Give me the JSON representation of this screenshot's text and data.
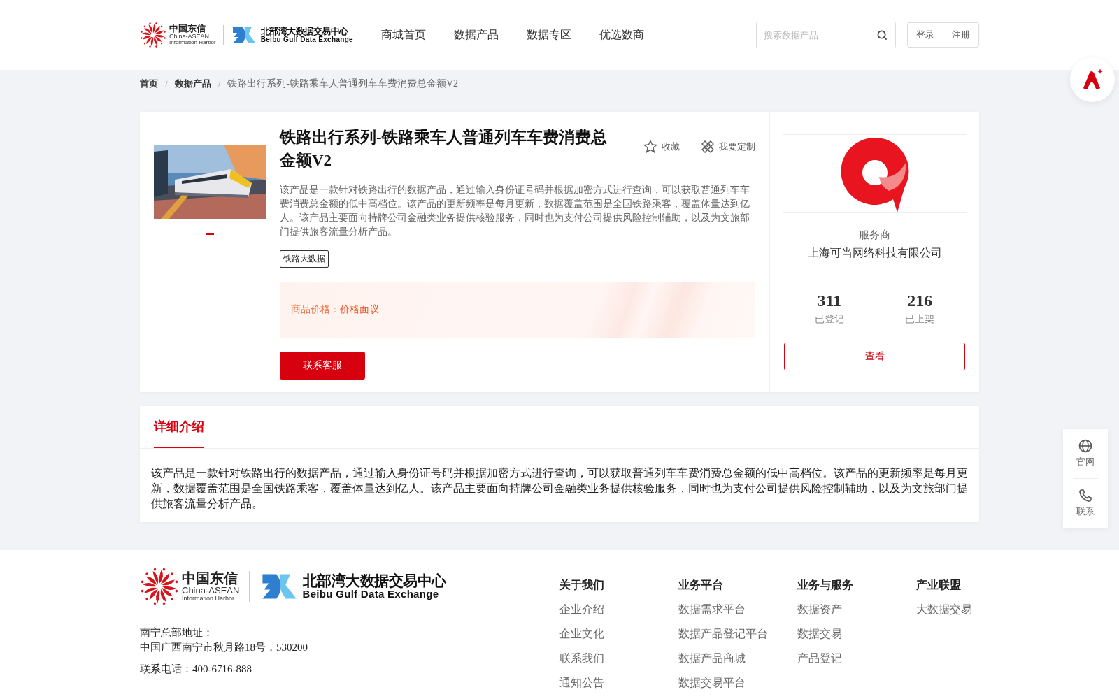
{
  "header": {
    "logo1": {
      "cn": "中国东信",
      "en": "China-ASEAN",
      "sub": "Information Harbor"
    },
    "logo2": {
      "cn": "北部湾大数据交易中心",
      "en": "Beibu Gulf Data Exchange"
    },
    "nav": [
      {
        "label": "商城首页",
        "selected": false
      },
      {
        "label": "数据产品",
        "selected": false
      },
      {
        "label": "数据专区",
        "selected": false
      },
      {
        "label": "优选数商",
        "selected": false
      }
    ],
    "search": {
      "placeholder": "搜索数据产品"
    },
    "auth": [
      "登录",
      "注册"
    ]
  },
  "breadcrumb_separator": "/",
  "breadcrumb": [
    "首页",
    "数据产品",
    "铁路出行系列-铁路乘车人普通列车车费消费总金额V2"
  ],
  "product": {
    "title": "铁路出行系列-铁路乘车人普通列车车费消费总金额V2",
    "actions": [
      {
        "kind": "star",
        "label": "收藏"
      },
      {
        "kind": "tool",
        "label": "我要定制"
      }
    ],
    "description": "该产品是一款针对铁路出行的数据产品，通过输入身份证号码并根据加密方式进行查询，可以获取普通列车车费消费总金额的低中高档位。该产品的更新频率是每月更新，数据覆盖范围是全国铁路乘客，覆盖体量达到亿人。该产品主要面向持牌公司金融类业务提供核验服务，同时也为支付公司提供风险控制辅助，以及为文旅部门提供旅客流量分析产品。",
    "tags": [
      "铁路大数据"
    ],
    "price_label": "商品价格：",
    "price": "价格面议",
    "contact_button": "联系客服"
  },
  "provider": {
    "label": "服务商",
    "name": "上海可当网络科技有限公司",
    "stats": [
      {
        "value": "311",
        "label": "已登记"
      },
      {
        "value": "216",
        "label": "已上架"
      }
    ],
    "button": "查看"
  },
  "details": {
    "tabs": [
      {
        "label": "详细介绍",
        "selected": true
      }
    ],
    "text": "该产品是一款针对铁路出行的数据产品，通过输入身份证号码并根据加密方式进行查询，可以获取普通列车车费消费总金额的低中高档位。该产品的更新频率是每月更新，数据覆盖范围是全国铁路乘客，覆盖体量达到亿人。该产品主要面向持牌公司金融类业务提供核验服务，同时也为支付公司提供风险控制辅助，以及为文旅部门提供旅客流量分析产品。"
  },
  "side_tools": [
    {
      "kind": "globe",
      "label": "官网"
    },
    {
      "kind": "phone",
      "label": "联系"
    }
  ],
  "footer": {
    "logo1": {
      "cn": "中国东信",
      "en": "China-ASEAN",
      "sub": "Information Harbor"
    },
    "logo2": {
      "cn": "北部湾大数据交易中心",
      "en": "Beibu Gulf Data Exchange"
    },
    "address_label": "南宁总部地址：",
    "address": "中国广西南宁市秋月路18号，530200",
    "phone": "联系电话：400-6716-888",
    "columns": [
      {
        "title": "关于我们",
        "links": [
          "企业介绍",
          "企业文化",
          "联系我们",
          "通知公告"
        ]
      },
      {
        "title": "业务平台",
        "links": [
          "数据需求平台",
          "数据产品登记平台",
          "数据产品商城",
          "数据交易平台"
        ]
      },
      {
        "title": "业务与服务",
        "links": [
          "数据资产",
          "数据交易",
          "产品登记"
        ]
      },
      {
        "title": "产业联盟",
        "links": [
          "大数据交易"
        ]
      }
    ]
  }
}
